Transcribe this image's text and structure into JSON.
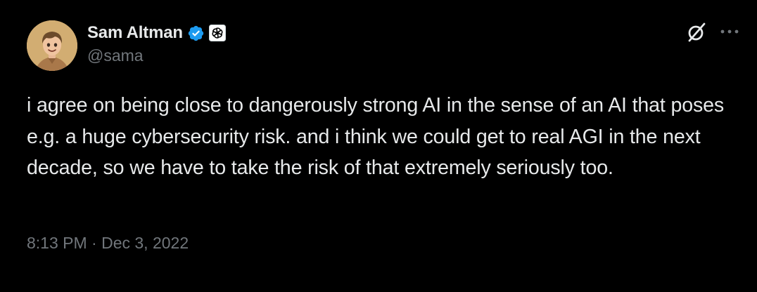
{
  "tweet": {
    "author": {
      "display_name": "Sam Altman",
      "handle": "@sama",
      "verified": true,
      "affiliate_badge": "openai-logo-icon"
    },
    "text": "i agree on being close to dangerously strong AI in the sense of an AI that poses e.g. a huge cybersecurity risk. and i think we could get to real AGI in the next decade, so we have to take the risk of that extremely seriously too.",
    "timestamp": "8:13 PM · Dec 3, 2022"
  },
  "icons": {
    "grok": "grok-icon",
    "more": "more-icon"
  },
  "colors": {
    "background": "#000000",
    "primary_text": "#e7e9ea",
    "secondary_text": "#71767b",
    "verified_blue": "#1d9bf0"
  }
}
